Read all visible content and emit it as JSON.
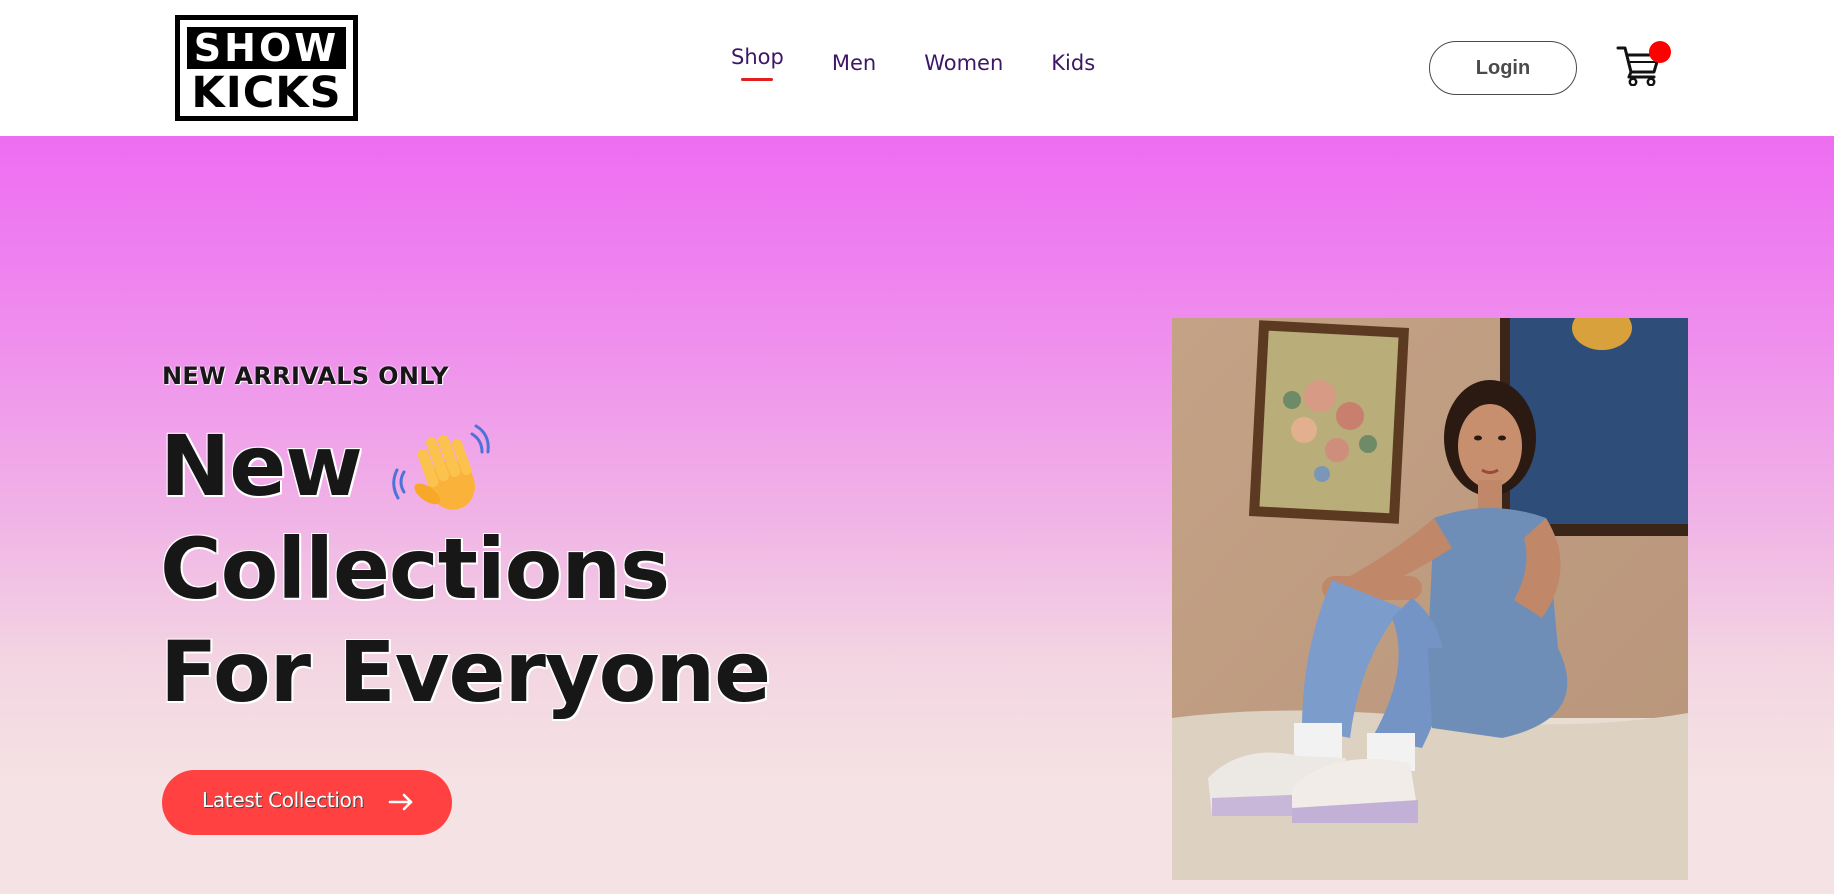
{
  "brand": {
    "logo_top": "SHOW",
    "logo_bottom": "KICKS"
  },
  "nav": {
    "items": [
      {
        "label": "Shop",
        "active": true
      },
      {
        "label": "Men"
      },
      {
        "label": "Women"
      },
      {
        "label": "Kids"
      }
    ],
    "active_underline_color": "#e0201f",
    "text_color": "#3d1766"
  },
  "header": {
    "login_label": "Login",
    "cart_icon": "cart-icon",
    "cart_badge_color": "#ff0000"
  },
  "hero": {
    "tagline": "NEW ARRIVALS ONLY",
    "headline_lines": [
      "New",
      "Collections",
      "For Everyone"
    ],
    "emoji_icon": "waving-hand-icon",
    "cta_label": "Latest Collection",
    "cta_icon": "arrow-right-icon",
    "cta_color": "#ff4141",
    "gradient_top": "#ee6df2",
    "gradient_bottom": "#f5e2e4"
  }
}
